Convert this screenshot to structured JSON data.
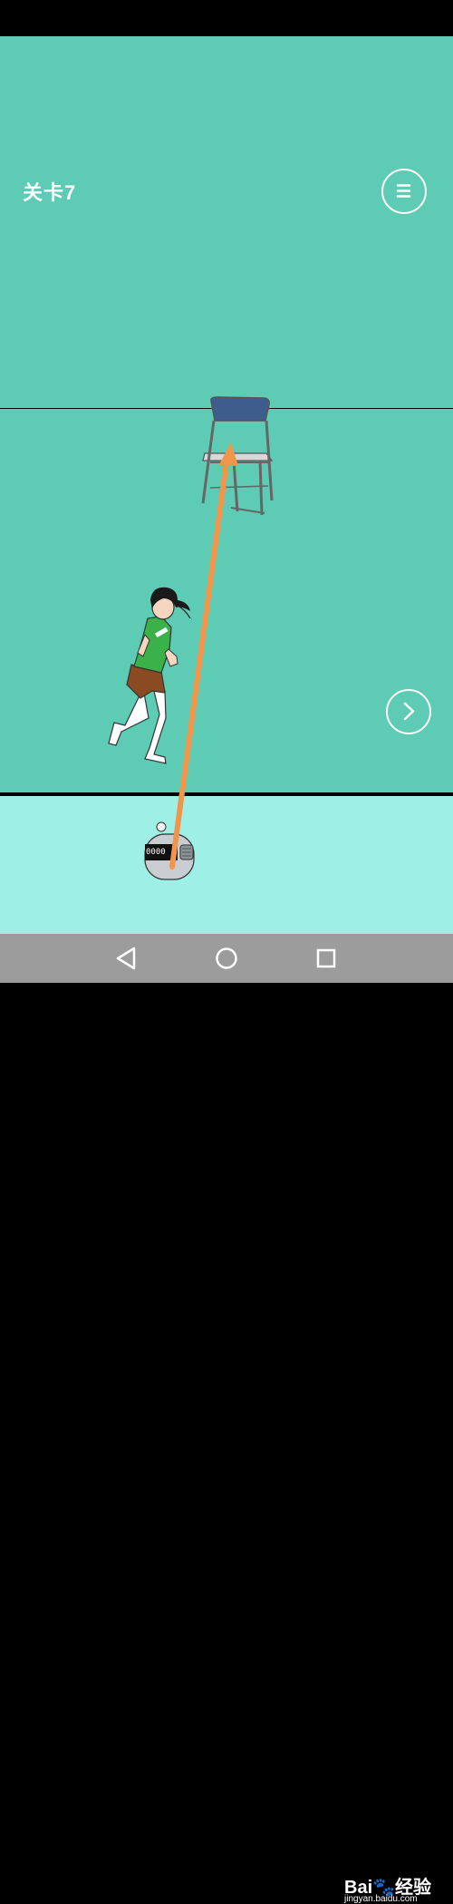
{
  "game": {
    "level_label": "关卡7",
    "counter_display": "0000",
    "icons": {
      "menu": "hamburger-menu-icon",
      "next": "chevron-right-icon",
      "arrow": "drag-arrow",
      "chair": "folding-chair",
      "player": "running-student",
      "counter": "tally-counter"
    },
    "colors": {
      "upper_bg": "#5ecbb4",
      "lower_bg": "#9ef0e6",
      "arrow": "#f0954a",
      "shirt": "#3bb14a",
      "shorts": "#8a4a22",
      "chair_seat": "#3e5d8e"
    }
  },
  "navbar": {
    "back": "back-triangle-icon",
    "home": "home-circle-icon",
    "recents": "recents-square-icon"
  },
  "watermark": {
    "brand": "Bai",
    "brand_suffix": "经验",
    "url": "jingyan.baidu.com"
  }
}
